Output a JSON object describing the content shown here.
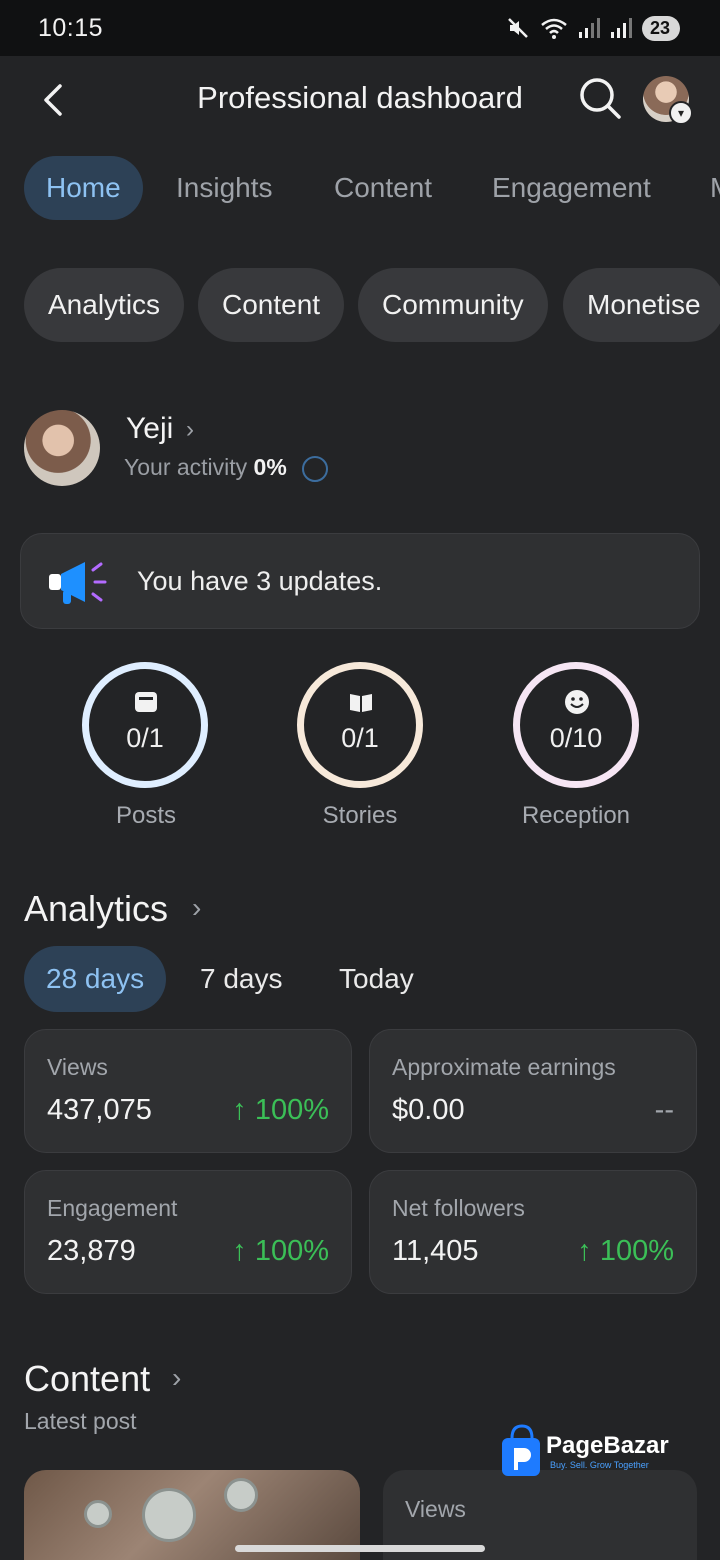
{
  "status_bar": {
    "time": "10:15",
    "battery": "23"
  },
  "header": {
    "title": "Professional dashboard"
  },
  "tabs": [
    {
      "label": "Home",
      "active": true
    },
    {
      "label": "Insights",
      "active": false
    },
    {
      "label": "Content",
      "active": false
    },
    {
      "label": "Engagement",
      "active": false
    },
    {
      "label": "M",
      "active": false
    }
  ],
  "chips": [
    "Analytics",
    "Content",
    "Community",
    "Monetise"
  ],
  "profile": {
    "name": "Yeji",
    "activity_label": "Your activity",
    "activity_value": "0%"
  },
  "updates": {
    "text": "You have 3 updates."
  },
  "goals": [
    {
      "label": "Posts",
      "value": "0/1",
      "color": "#dfeeff"
    },
    {
      "label": "Stories",
      "value": "0/1",
      "color": "#f7e9da"
    },
    {
      "label": "Reception",
      "value": "0/10",
      "color": "#f6e6f4"
    }
  ],
  "analytics": {
    "title": "Analytics",
    "periods": [
      "28 days",
      "7 days",
      "Today"
    ],
    "active_period": "28 days",
    "cards": [
      {
        "label": "Views",
        "value": "437,075",
        "delta": "↑ 100%"
      },
      {
        "label": "Approximate earnings",
        "value": "$0.00",
        "delta": "--"
      },
      {
        "label": "Engagement",
        "value": "23,879",
        "delta": "↑ 100%"
      },
      {
        "label": "Net followers",
        "value": "11,405",
        "delta": "↑ 100%"
      }
    ]
  },
  "content": {
    "title": "Content",
    "subtitle": "Latest post",
    "views_label": "Views"
  },
  "watermark": {
    "brand": "PageBazar",
    "tagline": "Buy. Sell. Grow Together"
  },
  "colors": {
    "accent": "#8ec2f2",
    "positive": "#3bbf57",
    "background": "#232426"
  }
}
